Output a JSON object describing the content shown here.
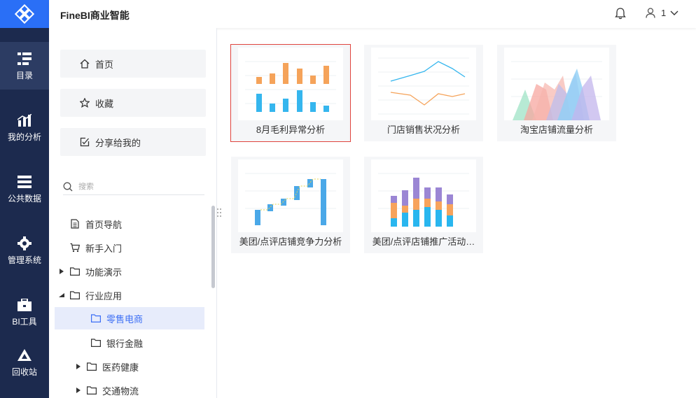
{
  "header": {
    "app_title": "FineBI商业智能",
    "user_name": "1"
  },
  "rail": {
    "items": [
      {
        "label": "目录",
        "icon": "catalog-icon"
      },
      {
        "label": "我的分析",
        "icon": "analysis-icon"
      },
      {
        "label": "公共数据",
        "icon": "public-data-icon"
      },
      {
        "label": "管理系统",
        "icon": "settings-gear-icon"
      },
      {
        "label": "BI工具",
        "icon": "toolbox-icon"
      },
      {
        "label": "回收站",
        "icon": "recycle-icon"
      }
    ]
  },
  "panel": {
    "quick": [
      {
        "label": "首页",
        "icon": "home-icon"
      },
      {
        "label": "收藏",
        "icon": "star-icon"
      },
      {
        "label": "分享给我的",
        "icon": "share-icon"
      }
    ],
    "search_placeholder": "搜索",
    "tree": [
      {
        "label": "首页导航",
        "icon": "document-icon"
      },
      {
        "label": "新手入门",
        "icon": "cart-icon"
      },
      {
        "label": "功能演示",
        "icon": "folder-icon"
      },
      {
        "label": "行业应用",
        "icon": "folder-icon"
      },
      {
        "label": "零售电商",
        "icon": "folder-icon"
      },
      {
        "label": "银行金融",
        "icon": "folder-icon"
      },
      {
        "label": "医药健康",
        "icon": "folder-icon"
      },
      {
        "label": "交通物流",
        "icon": "folder-icon"
      }
    ]
  },
  "cards": [
    {
      "label": "8月毛利异常分析",
      "thumb": "bar-chart"
    },
    {
      "label": "门店销售状况分析",
      "thumb": "line-chart"
    },
    {
      "label": "淘宝店铺流量分析",
      "thumb": "area-chart"
    },
    {
      "label": "美团/点评店铺竞争力分析",
      "thumb": "waterfall-chart"
    },
    {
      "label": "美团/点评店铺推广活动…",
      "thumb": "stacked-bar-chart"
    }
  ],
  "colors": {
    "rail_bg": "#1c2a4e",
    "accent": "#2a6ff6",
    "selected_text": "#3d6ff5",
    "card_border": "#e0443e"
  }
}
